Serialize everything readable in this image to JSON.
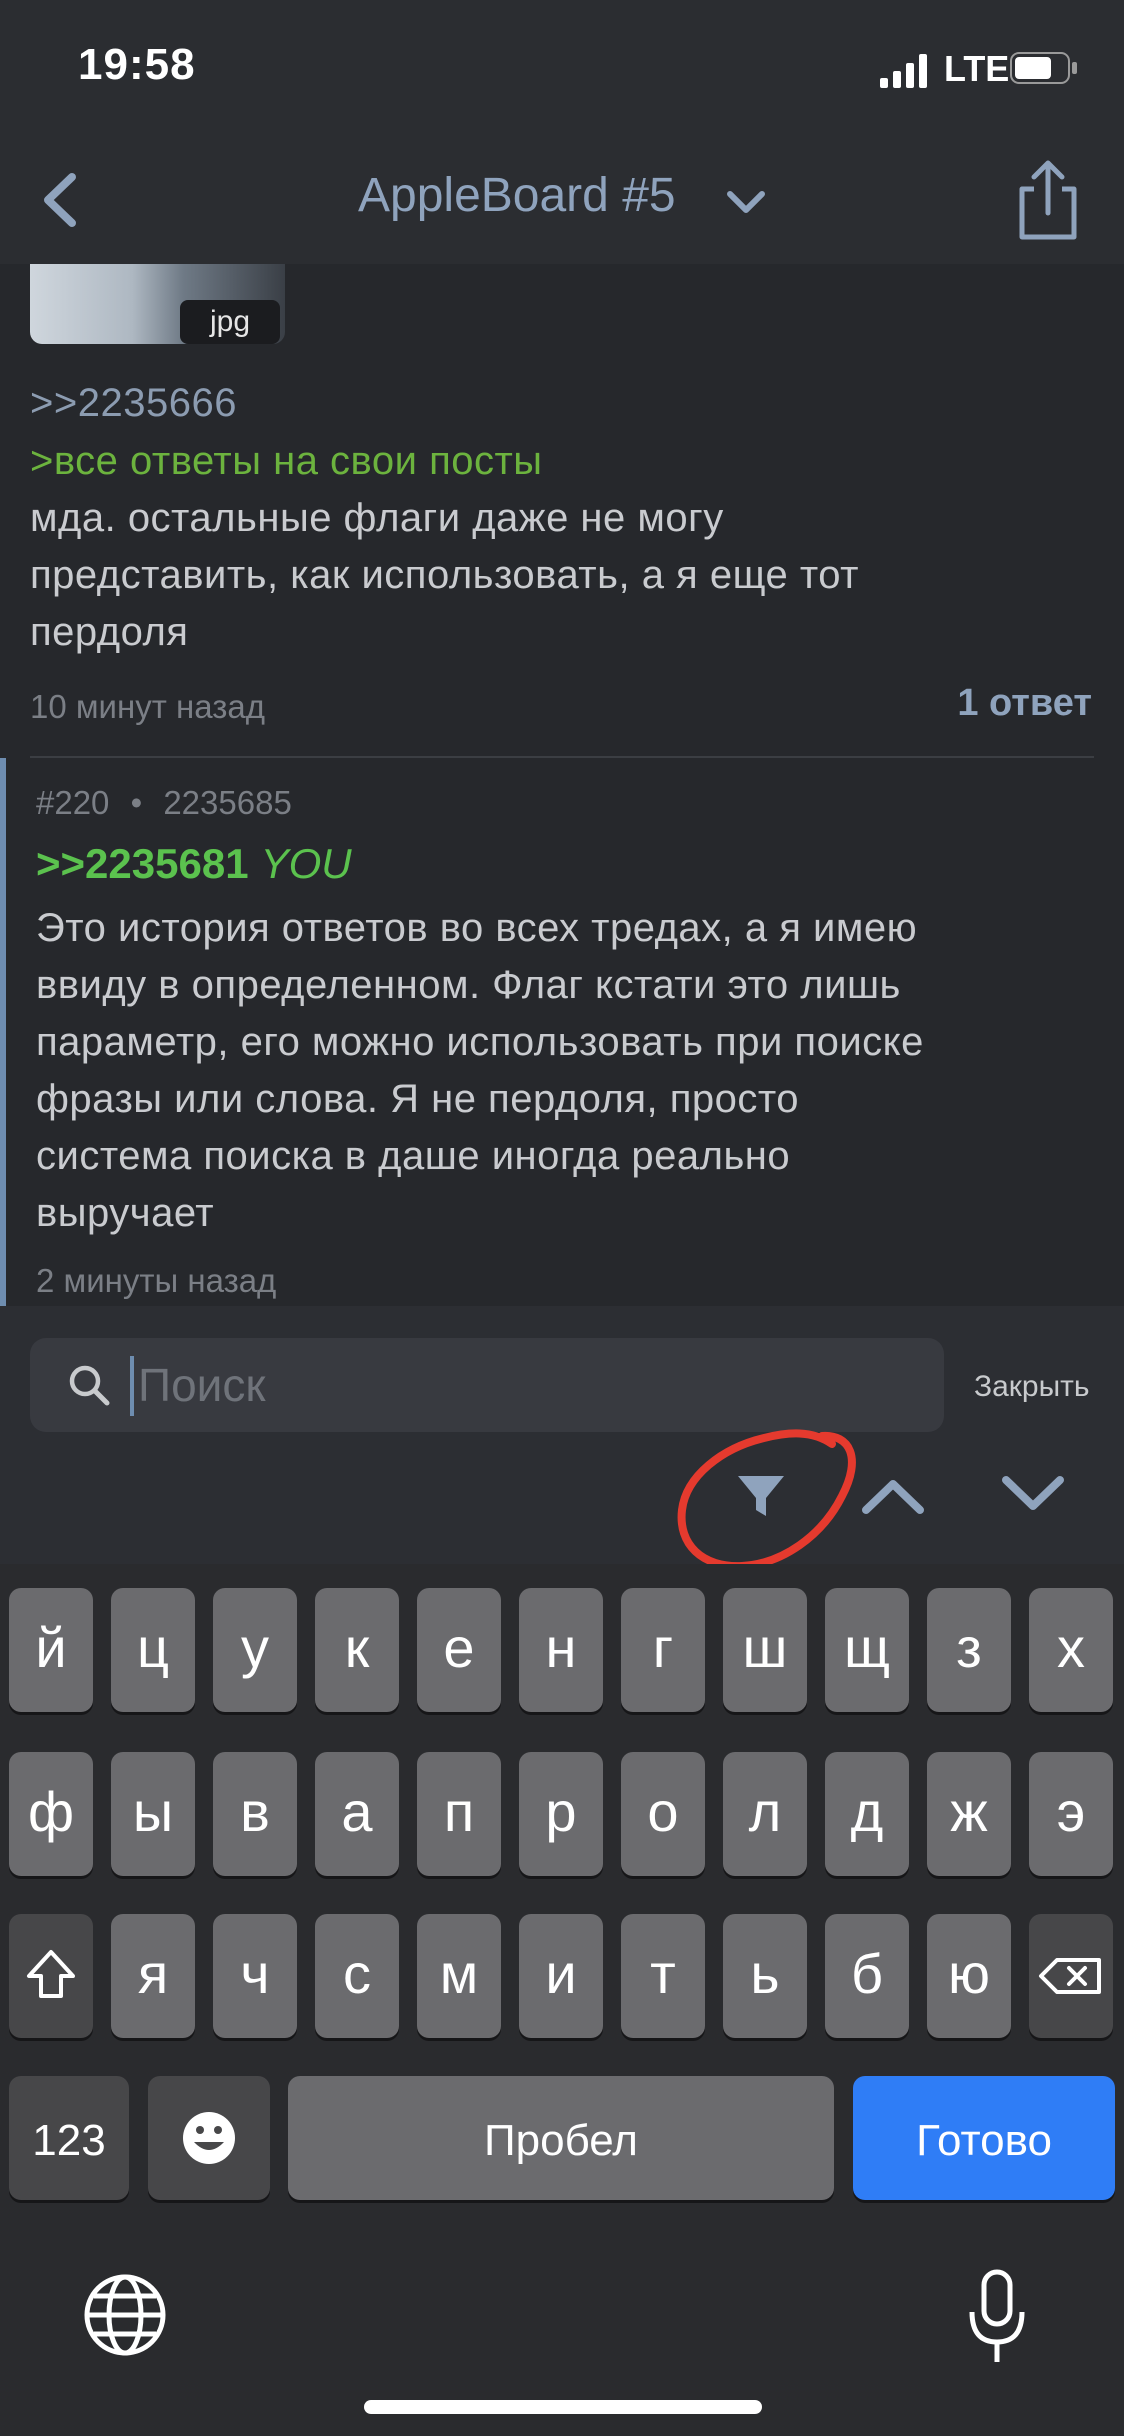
{
  "status": {
    "time": "19:58",
    "network": "LTE"
  },
  "nav": {
    "title": "AppleBoard #5"
  },
  "post1": {
    "image_badge": "jpg",
    "reply_ref": ">>2235666",
    "greentext": ">все ответы на свои посты",
    "body_lines": [
      "мда. остальные флаги даже не могу",
      "представить, как использовать, а я еще тот",
      "пердоля"
    ],
    "time": "10 минут назад",
    "replies": "1 ответ"
  },
  "post2": {
    "index": "#220",
    "sep": "•",
    "id": "2235685",
    "quote_ref": ">>2235681",
    "quote_you": "YOU",
    "body_lines": [
      "Это история ответов во всех тредах, а я имею",
      "ввиду в определенном. Флаг кстати это лишь",
      "параметр, его можно использовать при поиске",
      "фразы или слова. Я не пердоля, просто",
      "система поиска в даше иногда реально",
      "выручает"
    ],
    "time": "2 минуты назад"
  },
  "search": {
    "placeholder": "Поиск",
    "close_label": "Закрыть"
  },
  "keyboard": {
    "row1": [
      "й",
      "ц",
      "у",
      "к",
      "е",
      "н",
      "г",
      "ш",
      "щ",
      "з",
      "х"
    ],
    "row2": [
      "ф",
      "ы",
      "в",
      "а",
      "п",
      "р",
      "о",
      "л",
      "д",
      "ж",
      "э"
    ],
    "row3": [
      "я",
      "ч",
      "с",
      "м",
      "и",
      "т",
      "ь",
      "б",
      "ю"
    ],
    "numbers_label": "123",
    "space_label": "Пробел",
    "done_label": "Готово"
  },
  "colors": {
    "accent": "#2f7df6",
    "greentext": "#6cb33e",
    "annotation": "#e53a2e"
  }
}
